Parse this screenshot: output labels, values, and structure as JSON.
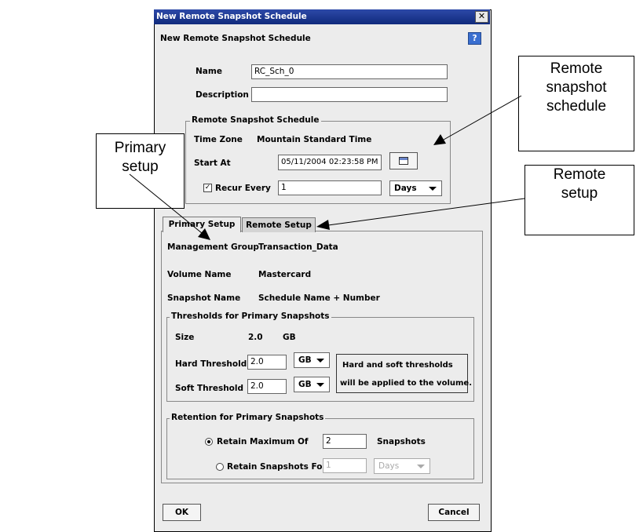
{
  "dialog": {
    "window_title": "New Remote Snapshot Schedule",
    "close_glyph": "✕",
    "heading": "New Remote Snapshot Schedule",
    "help_glyph": "?",
    "name_label": "Name",
    "name_value": "RC_Sch_0",
    "description_label": "Description",
    "description_value": ""
  },
  "schedule": {
    "legend": "Remote Snapshot Schedule",
    "time_zone_label": "Time Zone",
    "time_zone_value": "Mountain Standard Time",
    "start_at_label": "Start At",
    "start_at_value": "05/11/2004 02:23:58 PM",
    "recur_label": "Recur Every",
    "recur_checked": true,
    "recur_value": "1",
    "recur_unit": "Days"
  },
  "tabs": [
    {
      "label": "Primary Setup",
      "active": true
    },
    {
      "label": "Remote Setup",
      "active": false
    }
  ],
  "primary": {
    "management_group_label": "Management Group",
    "management_group_value": "Transaction_Data",
    "volume_name_label": "Volume Name",
    "volume_name_value": "Mastercard",
    "snapshot_name_label": "Snapshot Name",
    "snapshot_name_value": "Schedule Name + Number"
  },
  "thresholds": {
    "legend": "Thresholds for Primary Snapshots",
    "size_label": "Size",
    "size_value": "2.0",
    "size_unit": "GB",
    "hard_label": "Hard Threshold",
    "hard_value": "2.0",
    "hard_unit": "GB",
    "soft_label": "Soft Threshold",
    "soft_value": "2.0",
    "soft_unit": "GB",
    "note_line1": "Hard and soft thresholds",
    "note_line2": "will be applied to the volume."
  },
  "retention": {
    "legend": "Retention for Primary Snapshots",
    "max_label": "Retain Maximum Of",
    "max_value": "2",
    "max_suffix": "Snapshots",
    "max_selected": true,
    "for_label": "Retain Snapshots For",
    "for_value": "1",
    "for_unit": "Days"
  },
  "buttons": {
    "ok": "OK",
    "cancel": "Cancel"
  },
  "callouts": {
    "primary_setup": [
      "Primary",
      "setup"
    ],
    "remote_schedule": [
      "Remote",
      "snapshot",
      "schedule"
    ],
    "remote_setup": [
      "Remote",
      "setup"
    ]
  },
  "colors": {
    "titlebar": "#102a7c",
    "dialog_bg": "#ececec",
    "help_icon": "#3a6fd0"
  }
}
